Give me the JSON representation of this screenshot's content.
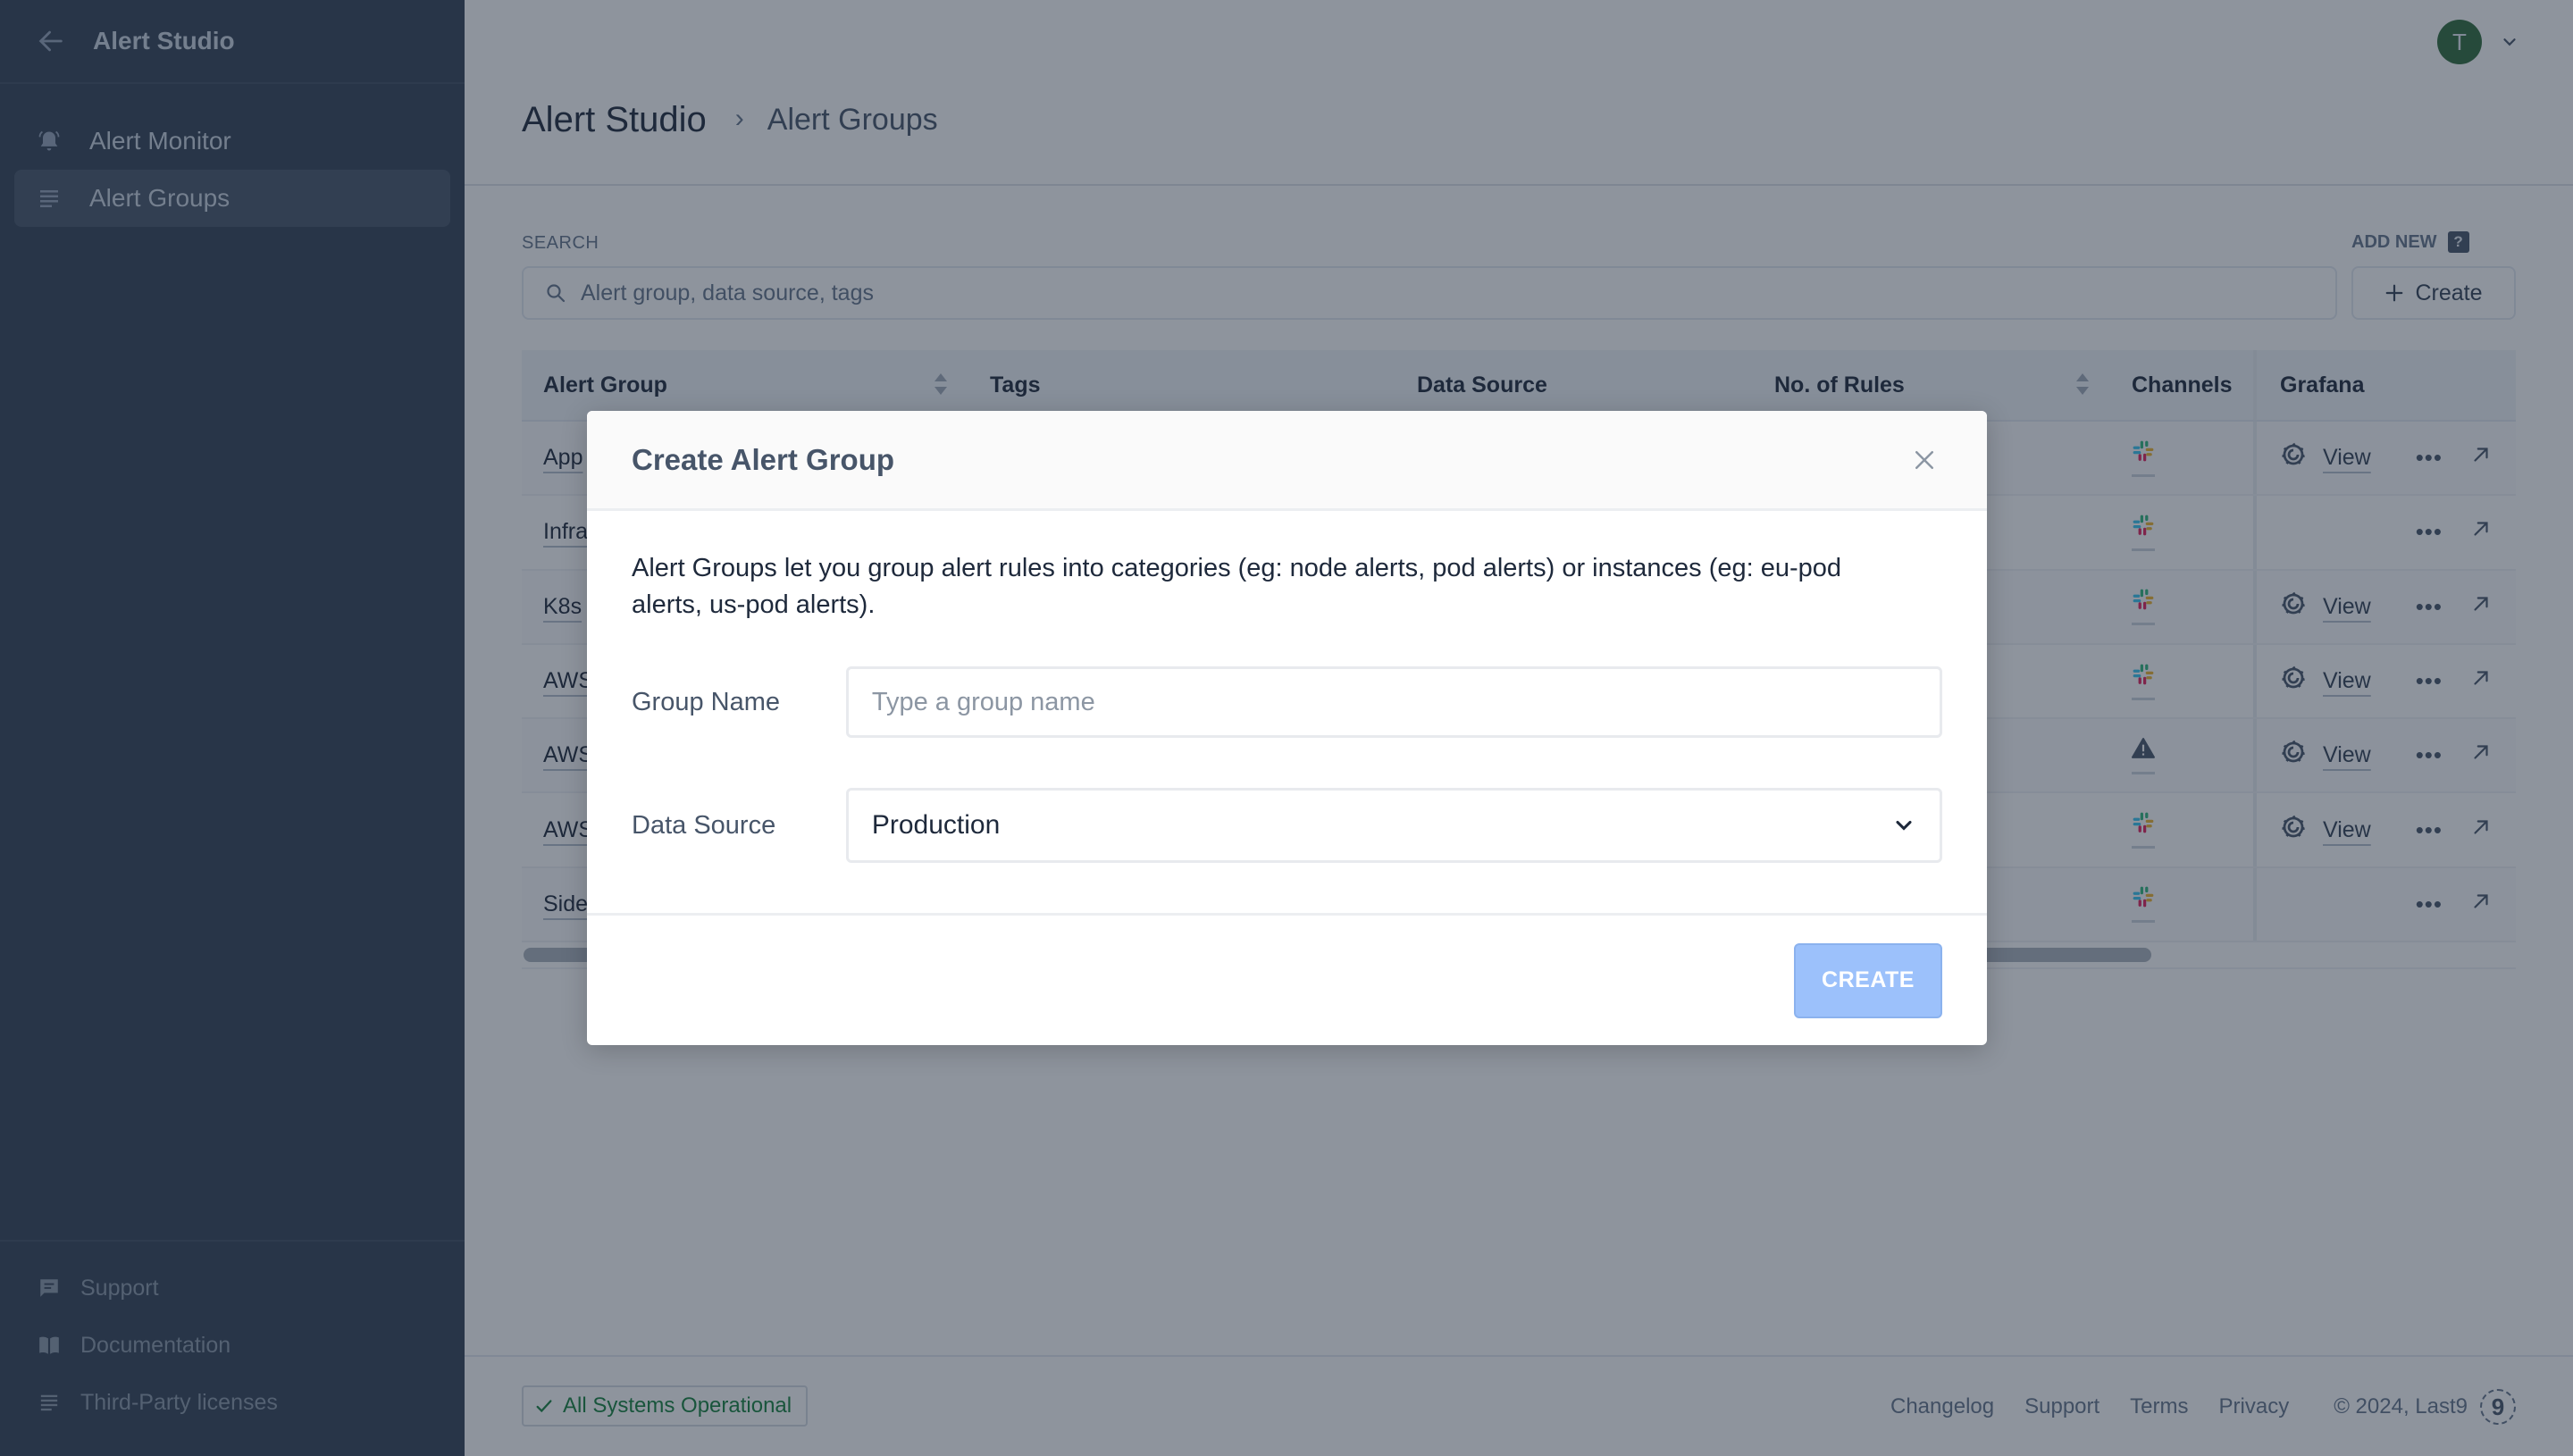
{
  "app": {
    "title": "Alert Studio"
  },
  "sidebar": {
    "items": [
      {
        "label": "Alert Monitor",
        "icon": "bell-ring-icon",
        "active": false
      },
      {
        "label": "Alert Groups",
        "icon": "list-icon",
        "active": true
      }
    ],
    "bottom_links": [
      {
        "label": "Support",
        "icon": "chat-icon"
      },
      {
        "label": "Documentation",
        "icon": "book-icon"
      },
      {
        "label": "Third-Party licenses",
        "icon": "list-icon"
      }
    ]
  },
  "user": {
    "avatar_initial": "T",
    "avatar_color": "#2f6b3a"
  },
  "breadcrumb": {
    "root": "Alert Studio",
    "separator": "›",
    "current": "Alert Groups"
  },
  "search": {
    "label": "SEARCH",
    "value": "",
    "placeholder": "Alert group, data source, tags"
  },
  "add_new": {
    "label": "ADD NEW",
    "help": "?",
    "button_label": "Create"
  },
  "table": {
    "columns": [
      "Alert Group",
      "Tags",
      "Data Source",
      "No. of Rules",
      "Channels",
      "Grafana"
    ],
    "rows": [
      {
        "group": "App",
        "channel": "slack",
        "grafana": "View"
      },
      {
        "group": "Infra",
        "channel": "slack",
        "grafana": ""
      },
      {
        "group": "K8s",
        "channel": "slack",
        "grafana": "View"
      },
      {
        "group": "AWS",
        "channel": "slack",
        "grafana": "View"
      },
      {
        "group": "AWS",
        "channel": "warning",
        "grafana": "View"
      },
      {
        "group": "AWS",
        "channel": "slack",
        "grafana": "View"
      },
      {
        "group": "Side",
        "channel": "slack",
        "grafana": ""
      }
    ],
    "more_label": "•••"
  },
  "footer": {
    "status": "All Systems Operational",
    "status_color": "#15803d",
    "links": [
      "Changelog",
      "Support",
      "Terms",
      "Privacy"
    ],
    "copyright": "© 2024, Last9",
    "logo": "9"
  },
  "modal": {
    "title": "Create Alert Group",
    "description": "Alert Groups let you group alert rules into categories (eg: node alerts, pod alerts) or instances (eg: eu-pod alerts, us-pod alerts).",
    "group_name_label": "Group Name",
    "group_name_value": "",
    "group_name_placeholder": "Type a group name",
    "data_source_label": "Data Source",
    "data_source_value": "Production",
    "create_label": "CREATE",
    "create_color": "#9cc1fb"
  }
}
